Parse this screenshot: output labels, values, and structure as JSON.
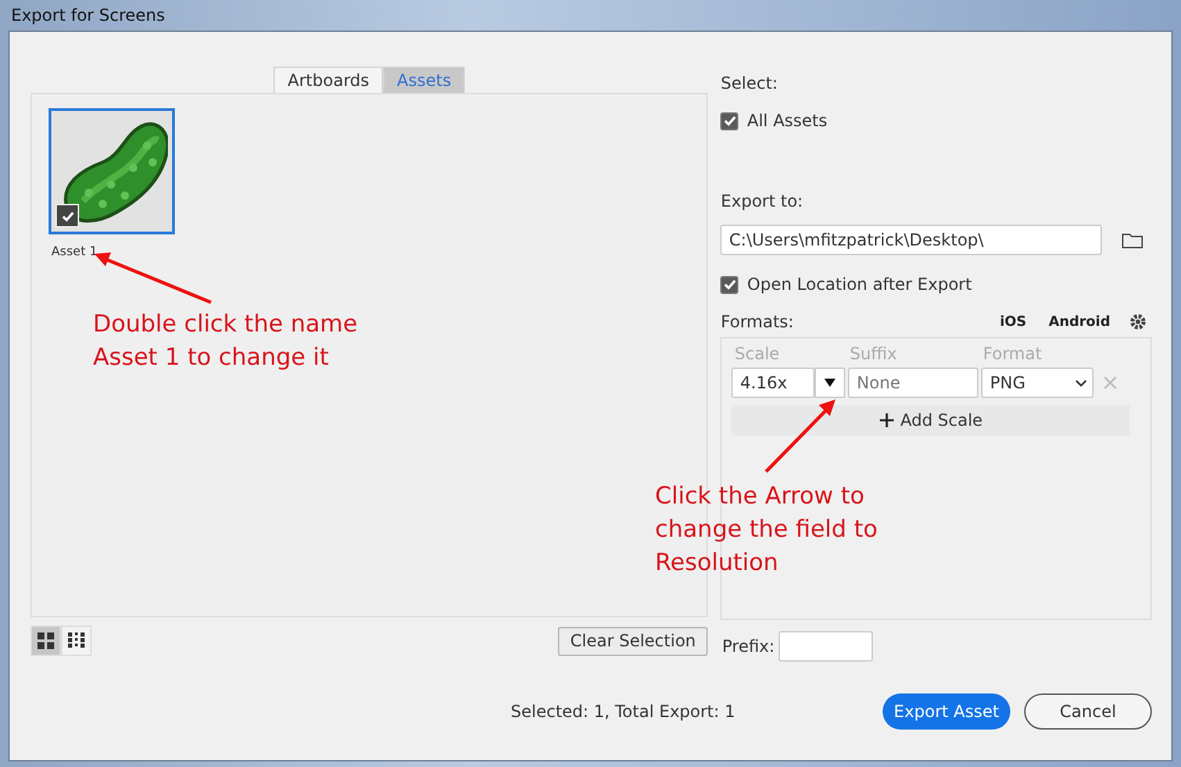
{
  "window": {
    "title": "Export for Screens"
  },
  "tabs": [
    {
      "label": "Artboards",
      "selected": false
    },
    {
      "label": "Assets",
      "selected": true
    }
  ],
  "assets": [
    {
      "name": "Asset 1",
      "selected": true,
      "checked": true
    }
  ],
  "view_toggles": [
    {
      "kind": "grid",
      "selected": true
    },
    {
      "kind": "list",
      "selected": false
    }
  ],
  "clear_selection": "Clear Selection",
  "select": {
    "label": "Select:",
    "option": {
      "label": "All Assets",
      "checked": true
    }
  },
  "export_to": {
    "label": "Export to:",
    "path": "C:\\Users\\mfitzpatrick\\Desktop\\"
  },
  "open_location": {
    "label": "Open Location after Export",
    "checked": true
  },
  "formats": {
    "label": "Formats:",
    "presets": [
      "iOS",
      "Android"
    ],
    "columns": [
      "Scale",
      "Suffix",
      "Format"
    ],
    "rows": [
      {
        "scale": "4.16x",
        "suffix": {
          "placeholder": "None"
        },
        "format": "PNG"
      }
    ],
    "add_scale": "Add Scale"
  },
  "prefix": {
    "label": "Prefix:"
  },
  "summary": "Selected: 1, Total Export: 1",
  "buttons": [
    {
      "label": "Export Asset",
      "kind": "primary"
    },
    {
      "label": "Cancel",
      "kind": "secondary"
    }
  ],
  "annotations": [
    {
      "lines": [
        "Double click the name",
        "Asset 1 to change it"
      ]
    },
    {
      "lines": [
        "Click the Arrow to",
        "change the field to",
        "Resolution"
      ]
    }
  ]
}
